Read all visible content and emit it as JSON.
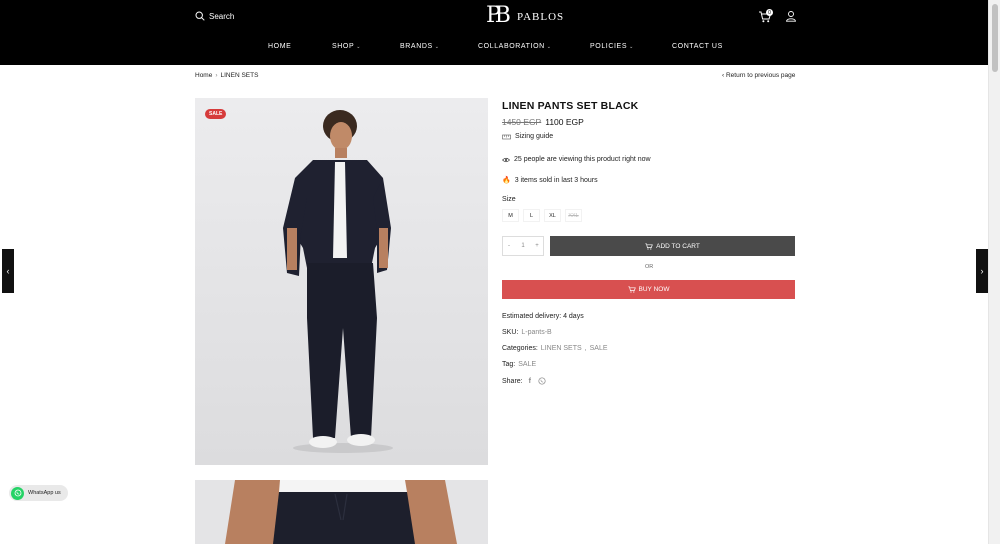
{
  "header": {
    "search_label": "Search",
    "logo_mark": "PB",
    "logo_text": "PABLOS",
    "logo_sub": "",
    "cart_count": "0",
    "nav": [
      {
        "label": "HOME",
        "has_caret": false
      },
      {
        "label": "SHOP",
        "has_caret": true
      },
      {
        "label": "BRANDS",
        "has_caret": true
      },
      {
        "label": "COLLABORATION",
        "has_caret": true
      },
      {
        "label": "POLICIES",
        "has_caret": true
      },
      {
        "label": "CONTACT US",
        "has_caret": false
      }
    ]
  },
  "breadcrumb": {
    "home": "Home",
    "separator": "›",
    "current": "LINEN SETS"
  },
  "back_link": "‹ Return to previous page",
  "product": {
    "sale_badge": "SALE",
    "title": "LINEN PANTS SET BLACK",
    "old_price": "1450 EGP",
    "new_price": "1100 EGP",
    "sizing_guide": "Sizing guide",
    "viewing": "25 people are viewing this product right now",
    "sold": "3 items sold in last 3 hours",
    "size_label": "Size",
    "sizes": [
      {
        "label": "M",
        "available": true
      },
      {
        "label": "L",
        "available": true
      },
      {
        "label": "XL",
        "available": true
      },
      {
        "label": "XXL",
        "available": false
      }
    ],
    "quantity": "1",
    "qty_minus": "-",
    "qty_plus": "+",
    "add_to_cart": "ADD TO CART",
    "or": "OR",
    "buy_now": "BUY NOW",
    "delivery": "Estimated delivery: 4 days",
    "sku_label": "SKU:",
    "sku_value": "L-pants-B",
    "categories_label": "Categories:",
    "categories": [
      "LINEN SETS",
      "SALE"
    ],
    "tag_label": "Tag:",
    "tag_value": "SALE",
    "share_label": "Share:"
  },
  "whatsapp_label": "WhatsApp us",
  "colors": {
    "header_bg": "#000000",
    "sale_red": "#d63b3b",
    "buy_now": "#d85050",
    "add_to_cart": "#4a4a4a",
    "whatsapp": "#25d366"
  },
  "icons": [
    "search-icon",
    "cart-icon",
    "user-icon",
    "ruler-icon",
    "eye-icon",
    "fire-icon",
    "cart-small-icon",
    "facebook-icon",
    "whatsapp-icon",
    "chevron-left-icon",
    "chevron-right-icon"
  ]
}
